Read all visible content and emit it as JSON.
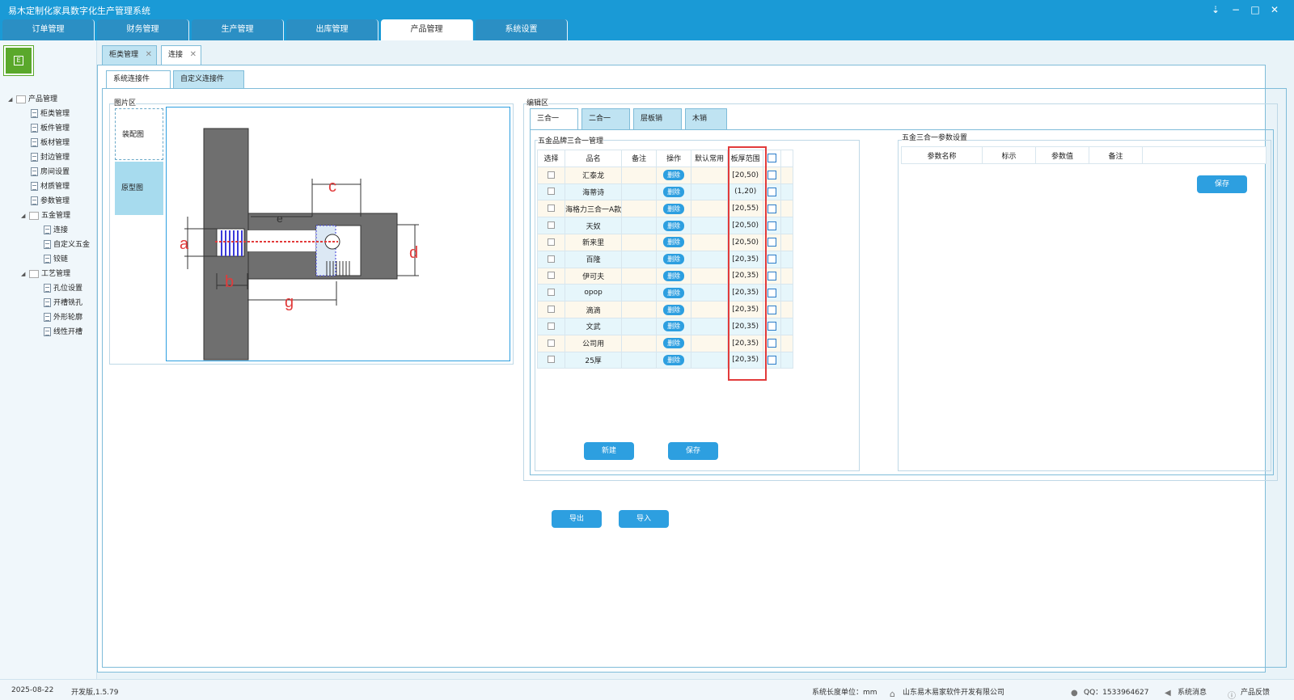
{
  "window": {
    "title": "易木定制化家具数字化生产管理系统",
    "controls": [
      "⇣",
      "−",
      "□",
      "✕"
    ]
  },
  "main_tabs": [
    {
      "label": "订单管理"
    },
    {
      "label": "财务管理"
    },
    {
      "label": "生产管理"
    },
    {
      "label": "出库管理"
    },
    {
      "label": "产品管理",
      "active": true
    },
    {
      "label": "系统设置"
    }
  ],
  "sidebar": {
    "logo_text": "E",
    "tree": [
      {
        "label": "产品管理",
        "level": 0,
        "expanded": true,
        "type": "folder"
      },
      {
        "label": "柜类管理",
        "level": 1,
        "type": "doc"
      },
      {
        "label": "板件管理",
        "level": 1,
        "type": "doc"
      },
      {
        "label": "板材管理",
        "level": 1,
        "type": "doc"
      },
      {
        "label": "封边管理",
        "level": 1,
        "type": "doc"
      },
      {
        "label": "房间设置",
        "level": 1,
        "type": "doc"
      },
      {
        "label": "材质管理",
        "level": 1,
        "type": "doc"
      },
      {
        "label": "参数管理",
        "level": 1,
        "type": "doc"
      },
      {
        "label": "五金管理",
        "level": 1,
        "expanded": true,
        "type": "folder"
      },
      {
        "label": "连接",
        "level": 2,
        "type": "doc"
      },
      {
        "label": "自定义五金",
        "level": 2,
        "type": "doc"
      },
      {
        "label": "铰链",
        "level": 2,
        "type": "doc"
      },
      {
        "label": "工艺管理",
        "level": 1,
        "expanded": true,
        "type": "folder"
      },
      {
        "label": "孔位设置",
        "level": 2,
        "type": "doc"
      },
      {
        "label": "开槽铣孔",
        "level": 2,
        "type": "doc"
      },
      {
        "label": "外形轮廓",
        "level": 2,
        "type": "doc"
      },
      {
        "label": "线性开槽",
        "level": 2,
        "type": "doc"
      }
    ]
  },
  "content_tabs": [
    {
      "label": "柜类管理",
      "close": "✕"
    },
    {
      "label": "连接",
      "close": "✕",
      "active": true
    }
  ],
  "sub_tabs": [
    {
      "label": "系统连接件",
      "active": true
    },
    {
      "label": "自定义连接件"
    }
  ],
  "image_area": {
    "title": "图片区",
    "buttons": [
      {
        "label": "装配图",
        "active": true
      },
      {
        "label": "原型图"
      }
    ],
    "diagram_labels": {
      "a": "a",
      "b": "b",
      "c": "c",
      "d": "d",
      "e": "e",
      "g": "g"
    }
  },
  "edit_area": {
    "title": "编辑区",
    "tabs": [
      {
        "label": "三合一",
        "active": true
      },
      {
        "label": "二合一"
      },
      {
        "label": "层板销"
      },
      {
        "label": "木销"
      }
    ],
    "group_title": "五金品牌三合一管理",
    "columns": [
      "选择",
      "品名",
      "备注",
      "操作",
      "默认常用",
      "板厚范围"
    ],
    "delete_label": "删除",
    "rows": [
      {
        "name": "汇泰龙",
        "remark": "",
        "range": "[20,50)"
      },
      {
        "name": "海蒂诗",
        "remark": "",
        "range": "(1,20)"
      },
      {
        "name": "海格力三合一A款",
        "remark": "",
        "range": "[20,55)"
      },
      {
        "name": "天奴",
        "remark": "",
        "range": "[20,50)"
      },
      {
        "name": "新来里",
        "remark": "",
        "range": "[20,50)"
      },
      {
        "name": "百隆",
        "remark": "",
        "range": "[20,35)"
      },
      {
        "name": "伊可夫",
        "remark": "",
        "range": "[20,35)"
      },
      {
        "name": "opop",
        "remark": "",
        "range": "[20,35)"
      },
      {
        "name": "滴滴",
        "remark": "",
        "range": "[20,35)"
      },
      {
        "name": "文武",
        "remark": "",
        "range": "[20,35)"
      },
      {
        "name": "公司用",
        "remark": "",
        "range": "[20,35)"
      },
      {
        "name": "25厚",
        "remark": "",
        "range": "[20,35)"
      }
    ],
    "new_button": "新建",
    "save_button": "保存"
  },
  "param_area": {
    "title": "五金三合一参数设置",
    "columns": [
      "参数名称",
      "标示",
      "参数值",
      "备注"
    ],
    "save_button": "保存"
  },
  "footer_buttons": {
    "export": "导出",
    "import": "导入"
  },
  "statusbar": {
    "date": "2025-08-22",
    "version": "开发版,1.5.79",
    "unit": "系统长度单位：mm",
    "company": "山东易木易家软件开发有限公司",
    "qq": "QQ：1533964627",
    "messages": "系统消息",
    "feedback": "产品反馈"
  }
}
